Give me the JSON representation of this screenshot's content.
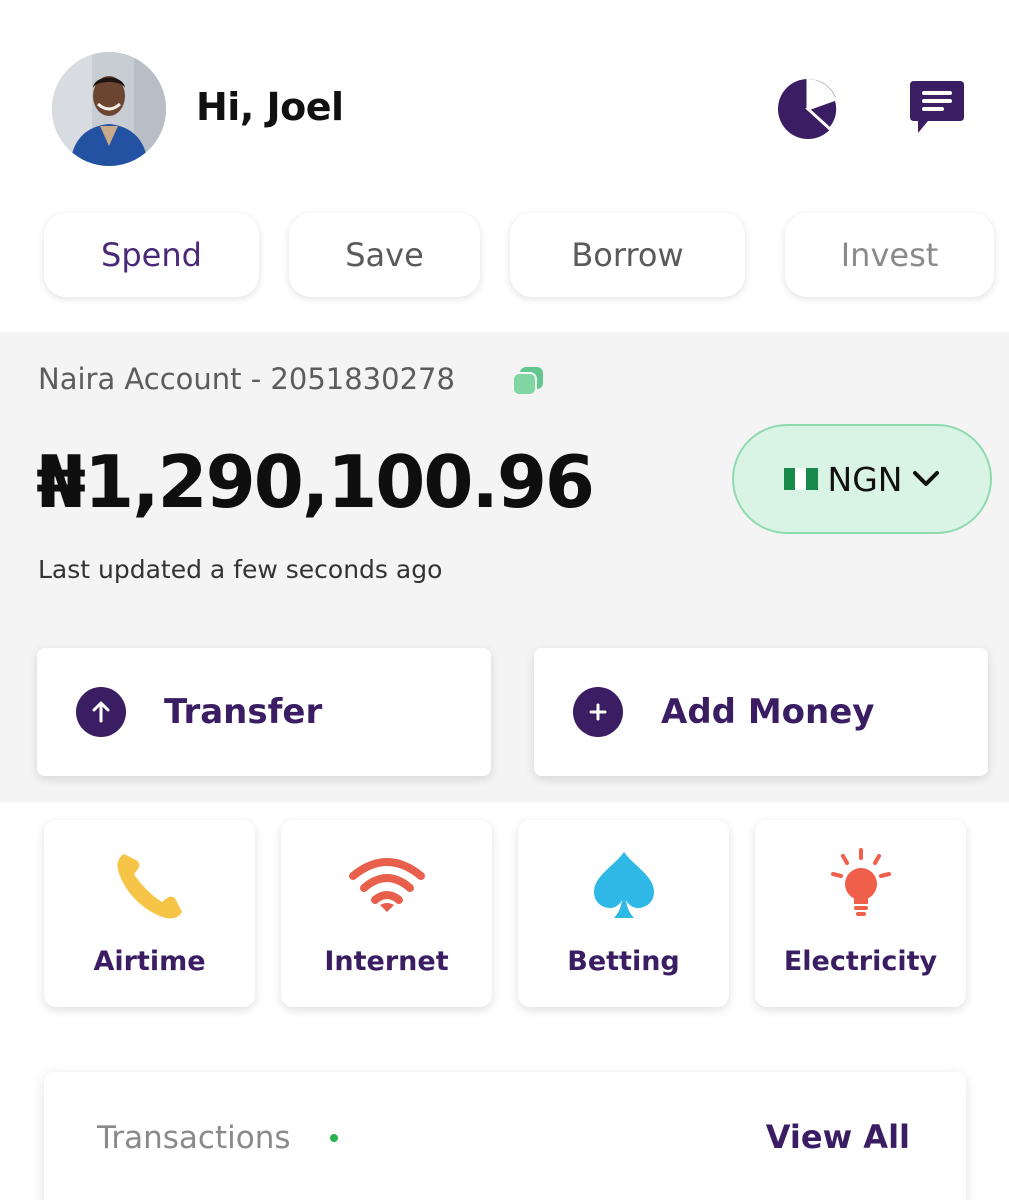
{
  "header": {
    "greeting": "Hi, Joel",
    "icons": [
      "pie-chart-icon",
      "chat-icon"
    ]
  },
  "tabs": [
    {
      "label": "Spend",
      "active": true
    },
    {
      "label": "Save",
      "active": false
    },
    {
      "label": "Borrow",
      "active": false
    },
    {
      "label": "Invest",
      "active": false
    }
  ],
  "account": {
    "label": "Naira Account - 2051830278",
    "balance": "₦1,290,100.96",
    "currency": "NGN",
    "updated": "Last updated a few seconds ago"
  },
  "actions": {
    "transfer": "Transfer",
    "add_money": "Add Money"
  },
  "services": [
    {
      "label": "Airtime",
      "icon": "phone-icon",
      "color": "#f6c547"
    },
    {
      "label": "Internet",
      "icon": "wifi-icon",
      "color": "#e8604c"
    },
    {
      "label": "Betting",
      "icon": "spade-icon",
      "color": "#2fb8e6"
    },
    {
      "label": "Electricity",
      "icon": "bulb-icon",
      "color": "#ef5f4a"
    }
  ],
  "transactions": {
    "title": "Transactions",
    "view_all": "View All"
  },
  "colors": {
    "brand": "#3a1d62",
    "accent_green": "#d9f3e4",
    "status_dot": "#2bb24c"
  }
}
